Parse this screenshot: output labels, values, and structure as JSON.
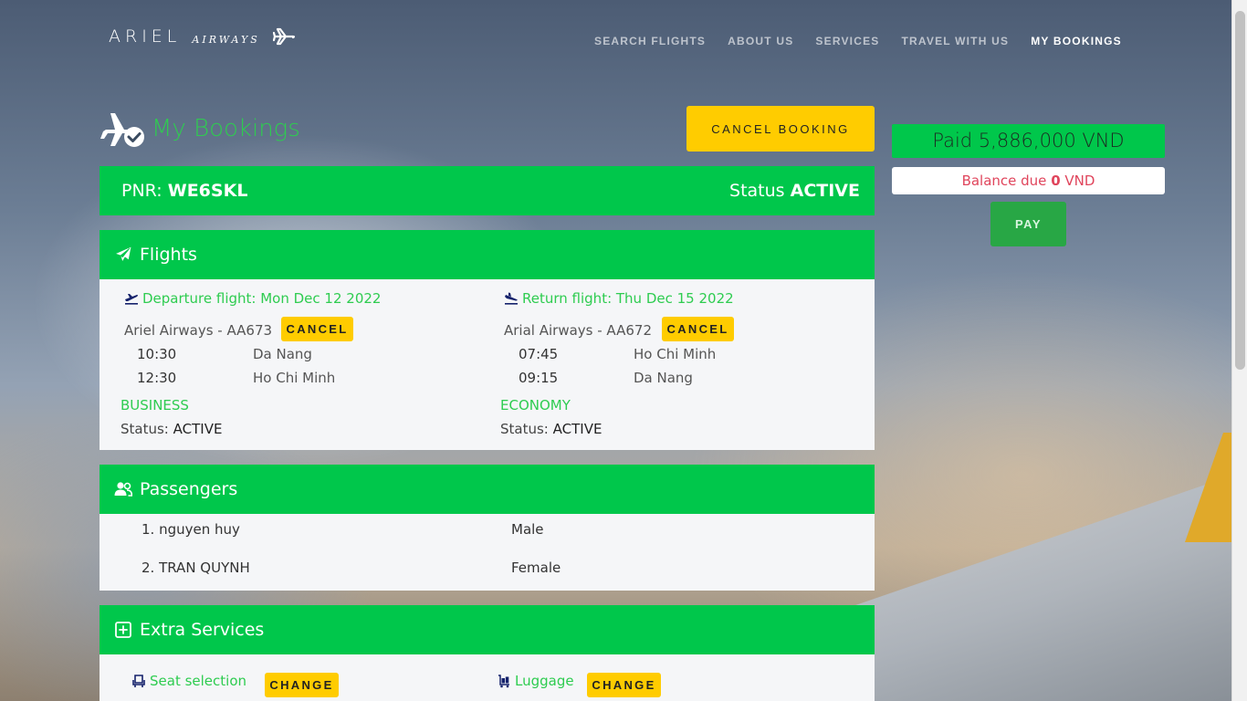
{
  "header": {
    "brand_main": "ARIEL",
    "brand_sub": "AIRWAYS",
    "nav": [
      {
        "label": "SEARCH FLIGHTS"
      },
      {
        "label": "ABOUT US"
      },
      {
        "label": "SERVICES"
      },
      {
        "label": "TRAVEL WITH US"
      },
      {
        "label": "MY BOOKINGS",
        "active": true
      }
    ]
  },
  "page": {
    "title": "My Bookings",
    "cancel_booking": "CANCEL BOOKING"
  },
  "payment": {
    "paid_label": "Paid 5,886,000 VND",
    "balance_prefix": "Balance due ",
    "balance_amount": "0",
    "balance_suffix": " VND",
    "pay_label": "PAY"
  },
  "booking": {
    "pnr_label": "PNR:",
    "pnr_value": "WE6SKL",
    "status_label": "Status",
    "status_value": "ACTIVE"
  },
  "flights": {
    "title": "Flights",
    "departure": {
      "heading": "Departure flight: Mon Dec 12 2022",
      "airline": "Ariel Airways - AA673",
      "cancel": "CANCEL",
      "dep_time": "10:30",
      "dep_city": "Da Nang",
      "arr_time": "12:30",
      "arr_city": "Ho Chi Minh",
      "class": "BUSINESS",
      "status_label": "Status:",
      "status_value": "ACTIVE"
    },
    "return": {
      "heading": "Return flight: Thu Dec 15 2022",
      "airline": "Arial Airways - AA672",
      "cancel": "CANCEL",
      "dep_time": "07:45",
      "dep_city": "Ho Chi Minh",
      "arr_time": "09:15",
      "arr_city": "Da Nang",
      "class": "ECONOMY",
      "status_label": "Status:",
      "status_value": "ACTIVE"
    }
  },
  "passengers": {
    "title": "Passengers",
    "list": [
      {
        "name": "1. nguyen huy",
        "gender": "Male"
      },
      {
        "name": "2. TRAN QUYNH",
        "gender": "Female"
      }
    ]
  },
  "extras": {
    "title": "Extra Services",
    "seat_label": "Seat selection",
    "seat_change": "CHANGE",
    "luggage_label": "Luggage",
    "luggage_change": "CHANGE"
  },
  "colors": {
    "green": "#00c74b",
    "text_green": "#2ecc50",
    "yellow": "#ffcc00",
    "pay_green": "#28a745",
    "balance_red": "#e0455c"
  }
}
